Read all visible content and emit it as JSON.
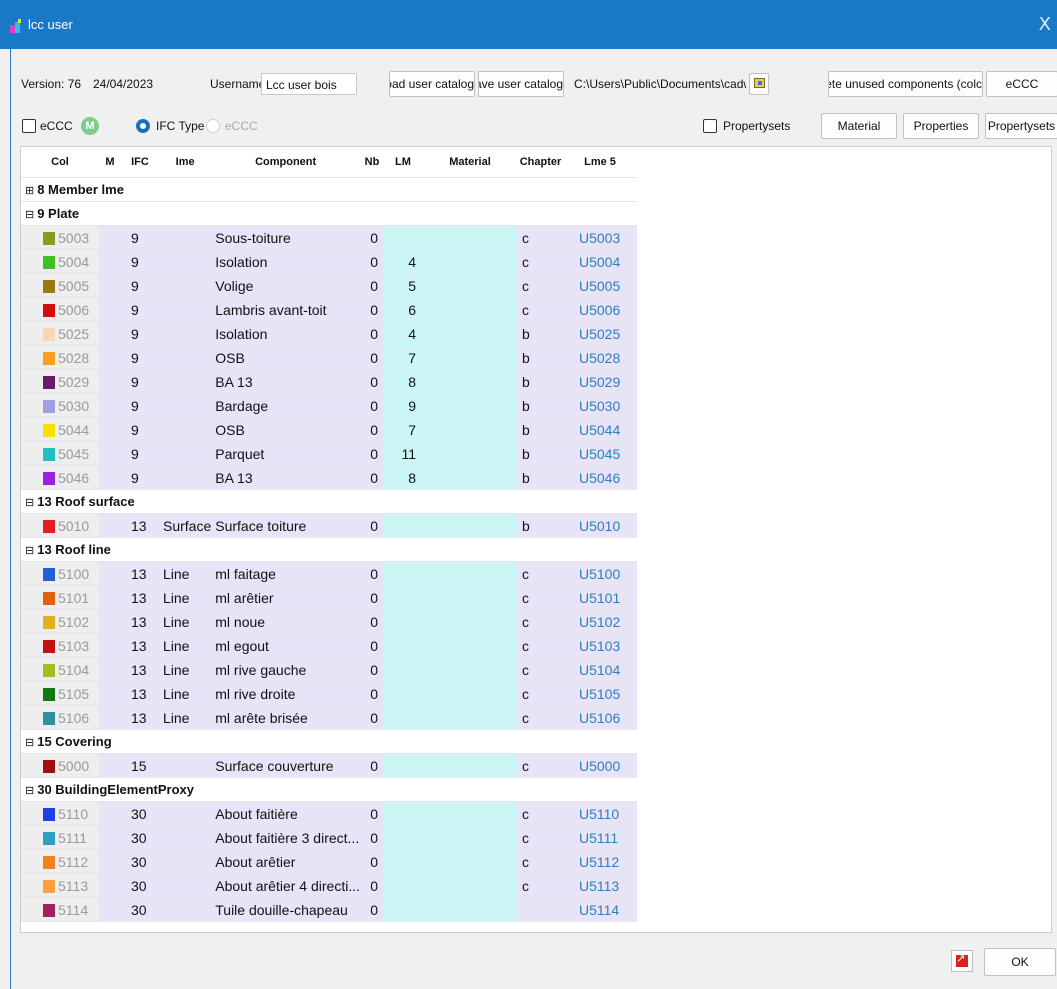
{
  "window": {
    "title": "lcc user",
    "close_glyph": "X"
  },
  "header": {
    "version_label": "Version: 76",
    "date": "24/04/2023",
    "username_label": "Username",
    "username_value": "Lcc user bois",
    "load_btn": "Load user catalog",
    "save_btn": "Save user catalog",
    "path": "C:\\Users\\Public\\Documents\\cadw",
    "delete_btn": "Delete unused components (colc",
    "eccc_btn": "eCCC"
  },
  "options": {
    "eccc_check_label": "eCCC",
    "m_badge": "M",
    "ifc_type_label": "IFC Type",
    "eccc_radio_label": "eCCC",
    "propertysets_check_label": "Propertysets",
    "material_btn": "Material",
    "properties_btn": "Properties",
    "propertysets_btn": "Propertysets"
  },
  "grid": {
    "columns": [
      "Col",
      "M",
      "IFC",
      "Ime",
      "Component",
      "Nb",
      "LM",
      "Material",
      "Chapter",
      "Lme 5"
    ],
    "groups": [
      {
        "label": "8 Member lme",
        "expander": "⊞",
        "rows": []
      },
      {
        "label": "9 Plate",
        "expander": "⊟",
        "rows": [
          {
            "color": "#8a9a20",
            "col": "5003",
            "ifc": "9",
            "ime": "",
            "component": "Sous-toiture",
            "nb": "0",
            "lm": "",
            "material": "",
            "chapter": "c",
            "lme": "U5003"
          },
          {
            "color": "#40c020",
            "col": "5004",
            "ifc": "9",
            "ime": "",
            "component": "Isolation",
            "nb": "0",
            "lm": "4",
            "material": "",
            "chapter": "c",
            "lme": "U5004"
          },
          {
            "color": "#9a7a10",
            "col": "5005",
            "ifc": "9",
            "ime": "",
            "component": "Volige",
            "nb": "0",
            "lm": "5",
            "material": "",
            "chapter": "c",
            "lme": "U5005"
          },
          {
            "color": "#cc1010",
            "col": "5006",
            "ifc": "9",
            "ime": "",
            "component": "Lambris avant-toit",
            "nb": "0",
            "lm": "6",
            "material": "",
            "chapter": "c",
            "lme": "U5006"
          },
          {
            "color": "#f8d8b0",
            "col": "5025",
            "ifc": "9",
            "ime": "",
            "component": "Isolation",
            "nb": "0",
            "lm": "4",
            "material": "",
            "chapter": "b",
            "lme": "U5025"
          },
          {
            "color": "#f8a020",
            "col": "5028",
            "ifc": "9",
            "ime": "",
            "component": "OSB",
            "nb": "0",
            "lm": "7",
            "material": "",
            "chapter": "b",
            "lme": "U5028"
          },
          {
            "color": "#6a1a6a",
            "col": "5029",
            "ifc": "9",
            "ime": "",
            "component": "BA 13",
            "nb": "0",
            "lm": "8",
            "material": "",
            "chapter": "b",
            "lme": "U5029"
          },
          {
            "color": "#a0a0e0",
            "col": "5030",
            "ifc": "9",
            "ime": "",
            "component": "Bardage",
            "nb": "0",
            "lm": "9",
            "material": "",
            "chapter": "b",
            "lme": "U5030"
          },
          {
            "color": "#f8e000",
            "col": "5044",
            "ifc": "9",
            "ime": "",
            "component": "OSB",
            "nb": "0",
            "lm": "7",
            "material": "",
            "chapter": "b",
            "lme": "U5044"
          },
          {
            "color": "#20c0c0",
            "col": "5045",
            "ifc": "9",
            "ime": "",
            "component": "Parquet",
            "nb": "0",
            "lm": "11",
            "material": "",
            "chapter": "b",
            "lme": "U5045"
          },
          {
            "color": "#9a20e0",
            "col": "5046",
            "ifc": "9",
            "ime": "",
            "component": "BA 13",
            "nb": "0",
            "lm": "8",
            "material": "",
            "chapter": "b",
            "lme": "U5046"
          }
        ]
      },
      {
        "label": "13 Roof surface",
        "expander": "⊟",
        "rows": [
          {
            "color": "#e02020",
            "col": "5010",
            "ifc": "13",
            "ime": "Surface",
            "component": "Surface toiture",
            "nb": "0",
            "lm": "",
            "material": "",
            "chapter": "b",
            "lme": "U5010"
          }
        ]
      },
      {
        "label": "13 Roof line",
        "expander": "⊟",
        "rows": [
          {
            "color": "#2060d0",
            "col": "5100",
            "ifc": "13",
            "ime": "Line",
            "component": "ml faitage",
            "nb": "0",
            "lm": "",
            "material": "",
            "chapter": "c",
            "lme": "U5100"
          },
          {
            "color": "#e06010",
            "col": "5101",
            "ifc": "13",
            "ime": "Line",
            "component": "ml arêtier",
            "nb": "0",
            "lm": "",
            "material": "",
            "chapter": "c",
            "lme": "U5101"
          },
          {
            "color": "#e0b020",
            "col": "5102",
            "ifc": "13",
            "ime": "Line",
            "component": "ml noue",
            "nb": "0",
            "lm": "",
            "material": "",
            "chapter": "c",
            "lme": "U5102"
          },
          {
            "color": "#c01010",
            "col": "5103",
            "ifc": "13",
            "ime": "Line",
            "component": "ml egout",
            "nb": "0",
            "lm": "",
            "material": "",
            "chapter": "c",
            "lme": "U5103"
          },
          {
            "color": "#a0c020",
            "col": "5104",
            "ifc": "13",
            "ime": "Line",
            "component": "ml rive gauche",
            "nb": "0",
            "lm": "",
            "material": "",
            "chapter": "c",
            "lme": "U5104"
          },
          {
            "color": "#107a10",
            "col": "5105",
            "ifc": "13",
            "ime": "Line",
            "component": "ml rive droite",
            "nb": "0",
            "lm": "",
            "material": "",
            "chapter": "c",
            "lme": "U5105"
          },
          {
            "color": "#3090a0",
            "col": "5106",
            "ifc": "13",
            "ime": "Line",
            "component": "ml arête brisée",
            "nb": "0",
            "lm": "",
            "material": "",
            "chapter": "c",
            "lme": "U5106"
          }
        ]
      },
      {
        "label": "15 Covering",
        "expander": "⊟",
        "rows": [
          {
            "color": "#a01010",
            "col": "5000",
            "ifc": "15",
            "ime": "",
            "component": "Surface couverture",
            "nb": "0",
            "lm": "",
            "material": "",
            "chapter": "c",
            "lme": "U5000"
          }
        ]
      },
      {
        "label": "30 BuildingElementProxy",
        "expander": "⊟",
        "rows": [
          {
            "color": "#2040e0",
            "col": "5110",
            "ifc": "30",
            "ime": "",
            "component": "About faitière",
            "nb": "0",
            "lm": "",
            "material": "",
            "chapter": "c",
            "lme": "U5110"
          },
          {
            "color": "#30a0c0",
            "col": "5111",
            "ifc": "30",
            "ime": "",
            "component": "About faitière 3 direct...",
            "nb": "0",
            "lm": "",
            "material": "",
            "chapter": "c",
            "lme": "U5111"
          },
          {
            "color": "#f08020",
            "col": "5112",
            "ifc": "30",
            "ime": "",
            "component": "About arêtier",
            "nb": "0",
            "lm": "",
            "material": "",
            "chapter": "c",
            "lme": "U5112"
          },
          {
            "color": "#f8a040",
            "col": "5113",
            "ifc": "30",
            "ime": "",
            "component": "About arêtier 4 directi...",
            "nb": "0",
            "lm": "",
            "material": "",
            "chapter": "c",
            "lme": "U5113"
          },
          {
            "color": "#a02060",
            "col": "5114",
            "ifc": "30",
            "ime": "",
            "component": "Tuile douille-chapeau",
            "nb": "0",
            "lm": "",
            "material": "",
            "chapter": "",
            "lme": "U5114"
          }
        ]
      }
    ]
  },
  "footer": {
    "ok_btn": "OK",
    "icon": "export-arrow-icon"
  }
}
